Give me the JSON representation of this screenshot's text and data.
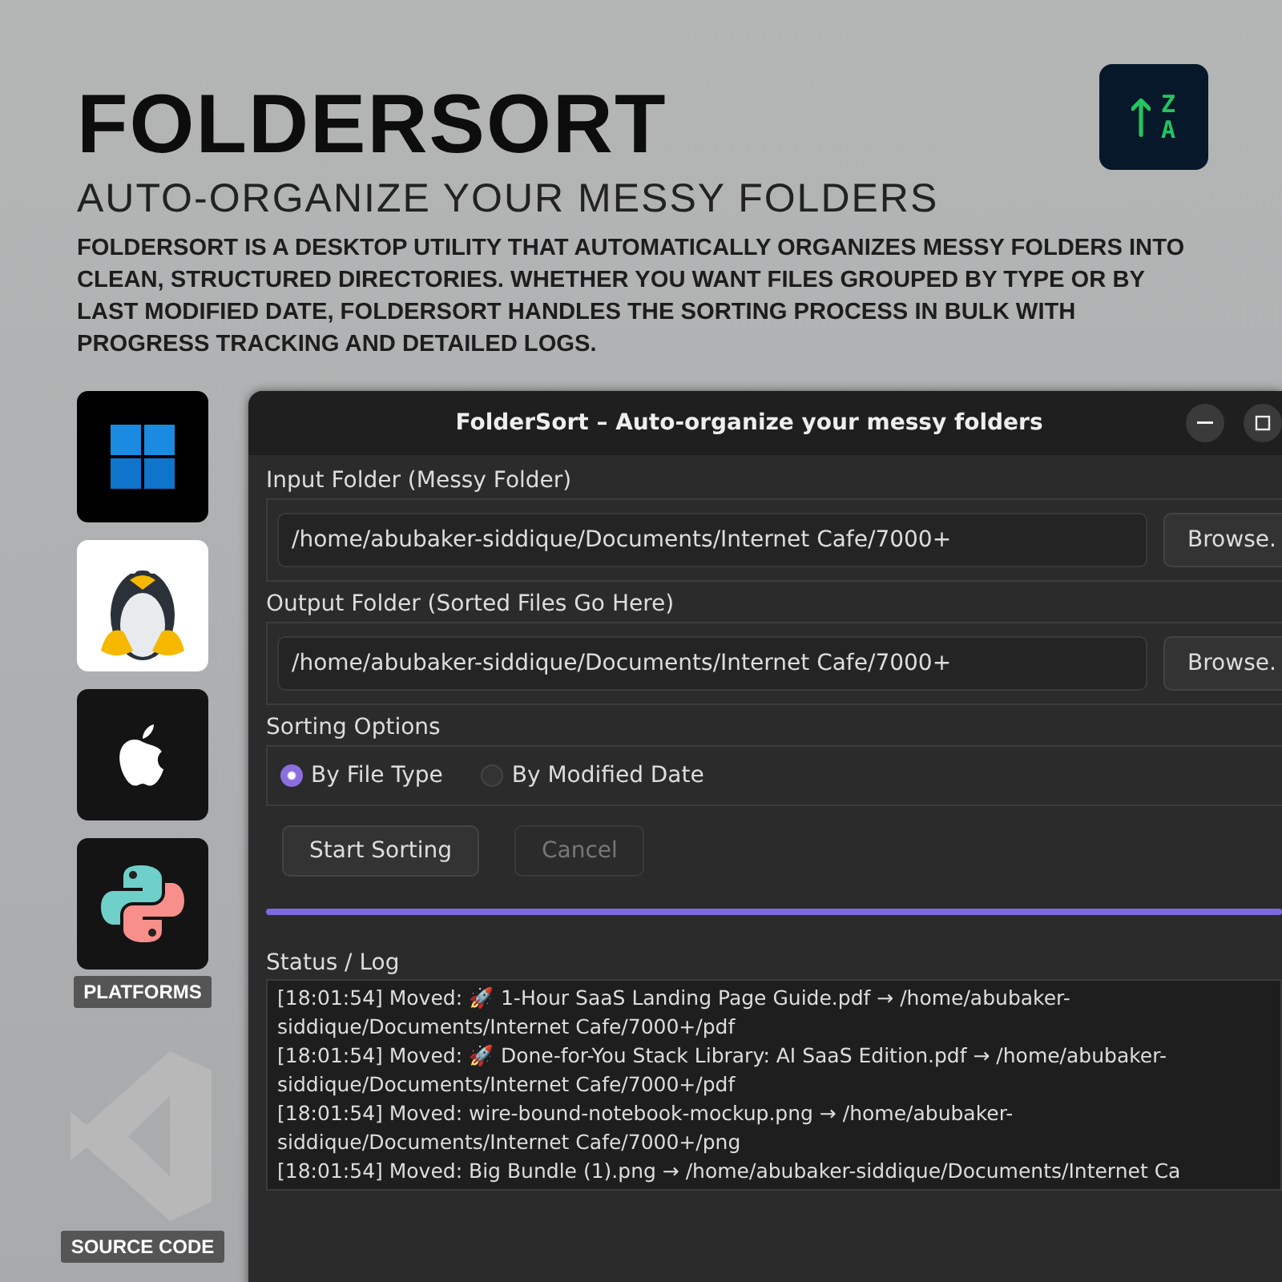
{
  "header": {
    "title": "FOLDERSORT",
    "subtitle": "AUTO-ORGANIZE YOUR MESSY FOLDERS",
    "description": "FOLDERSORT IS A DESKTOP UTILITY THAT AUTOMATICALLY ORGANIZES MESSY FOLDERS INTO CLEAN, STRUCTURED DIRECTORIES. WHETHER YOU WANT FILES GROUPED BY TYPE OR BY LAST MODIFIED DATE, FOLDERSORT HANDLES THE SORTING PROCESS IN BULK WITH PROGRESS TRACKING AND DETAILED LOGS.",
    "logo": {
      "top": "Z",
      "bottom": "A"
    }
  },
  "platforms": [
    {
      "kind": "windows"
    },
    {
      "kind": "linux"
    },
    {
      "kind": "apple"
    },
    {
      "kind": "python"
    }
  ],
  "platforms_label": "PLATFORMS",
  "source_label": "SOURCE CODE",
  "window": {
    "title": "FolderSort – Auto-organize your messy folders",
    "input": {
      "label": "Input Folder (Messy Folder)",
      "value": "/home/abubaker-siddique/Documents/Internet Cafe/7000+",
      "button": "Browse."
    },
    "output": {
      "label": "Output Folder (Sorted Files Go Here)",
      "value": "/home/abubaker-siddique/Documents/Internet Cafe/7000+",
      "button": "Browse."
    },
    "sorting": {
      "label": "Sorting Options",
      "options": [
        {
          "label": "By File Type",
          "selected": true
        },
        {
          "label": "By Modified Date",
          "selected": false
        }
      ]
    },
    "buttons": [
      {
        "label": "Start Sorting",
        "disabled": false
      },
      {
        "label": "Cancel",
        "disabled": true
      }
    ],
    "progress": {
      "level": 1
    },
    "log": {
      "label": "Status / Log",
      "entries": [
        "[18:01:54] Moved: 🚀 1-Hour SaaS Landing Page Guide.pdf → /home/abubaker-siddique/Documents/Internet Cafe/7000+/pdf",
        "[18:01:54] Moved: 🚀 Done-for-You Stack Library: AI SaaS Edition.pdf → /home/abubaker-siddique/Documents/Internet Cafe/7000+/pdf",
        "[18:01:54] Moved: wire-bound-notebook-mockup.png → /home/abubaker-siddique/Documents/Internet Cafe/7000+/png",
        "[18:01:54] Moved: Big Bundle (1).png → /home/abubaker-siddique/Documents/Internet Ca"
      ]
    }
  }
}
